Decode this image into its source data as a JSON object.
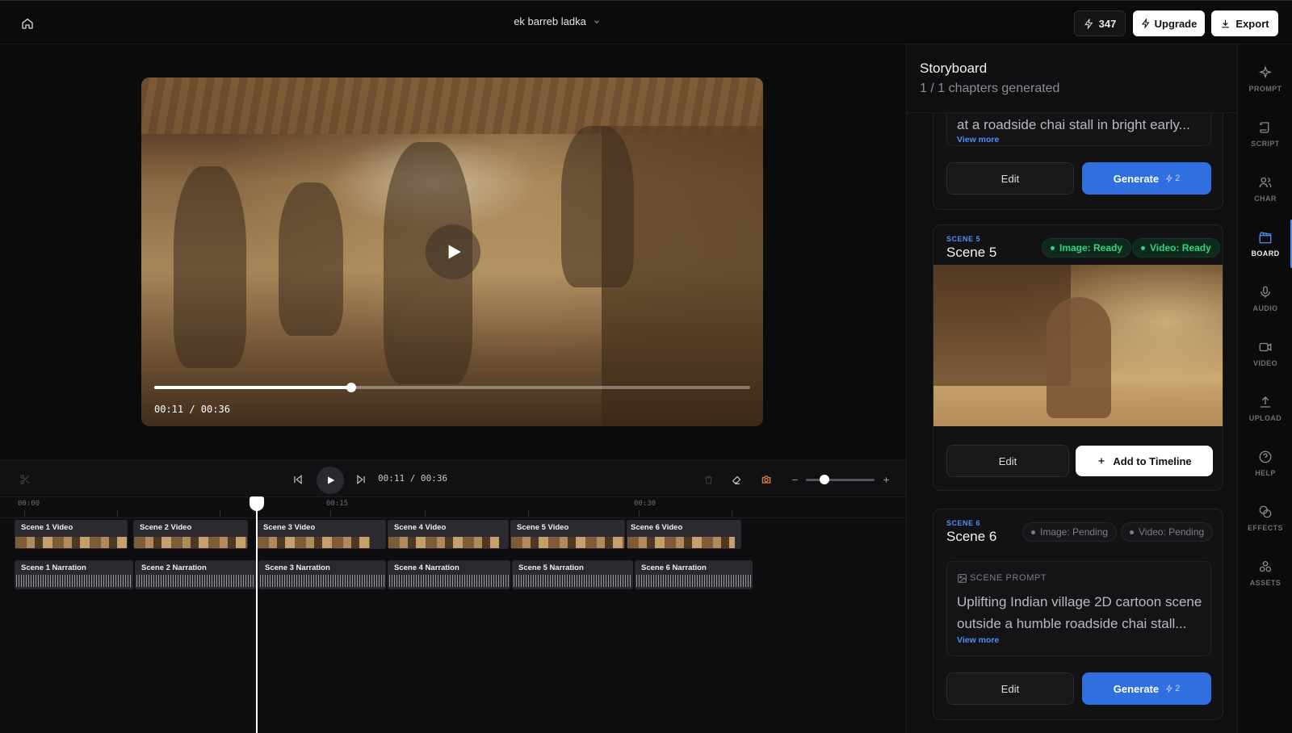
{
  "header": {
    "project_title": "ek barreb ladka",
    "credits": "347",
    "upgrade_label": "Upgrade",
    "export_label": "Export"
  },
  "preview": {
    "time_display": "00:11 / 00:36",
    "progress": 0.33
  },
  "timeline": {
    "time_display": "00:11 / 00:36",
    "ruler": [
      "00:00",
      "00:15",
      "00:30"
    ],
    "video_clips": [
      "Scene 1 Video",
      "Scene 2 Video",
      "Scene 3 Video",
      "Scene 4 Video",
      "Scene 5 Video",
      "Scene 6 Video"
    ],
    "narration_clips": [
      "Scene 1 Narration",
      "Scene 2 Narration",
      "Scene 3 Narration",
      "Scene 4 Narration",
      "Scene 5 Narration",
      "Scene 6 Narration"
    ]
  },
  "storyboard": {
    "title": "Storyboard",
    "subtitle": "1 / 1 chapters generated",
    "scene4": {
      "prompt_tail": "at a roadside chai stall in bright early...",
      "view_more": "View more",
      "edit_label": "Edit",
      "generate_label": "Generate",
      "generate_cost": "2"
    },
    "scene5": {
      "kicker": "SCENE 5",
      "name": "Scene 5",
      "image_status": "Image: Ready",
      "video_status": "Video: Ready",
      "edit_label": "Edit",
      "add_label": "Add to Timeline"
    },
    "scene6": {
      "kicker": "SCENE 6",
      "name": "Scene 6",
      "image_status": "Image: Pending",
      "video_status": "Video: Pending",
      "prompt_label": "SCENE PROMPT",
      "prompt_text": "Uplifting Indian village 2D cartoon scene outside a humble roadside chai stall...",
      "view_more": "View more",
      "edit_label": "Edit",
      "generate_label": "Generate",
      "generate_cost": "2"
    }
  },
  "rail": {
    "items": [
      "PROMPT",
      "SCRIPT",
      "CHAR",
      "BOARD",
      "AUDIO",
      "VIDEO",
      "UPLOAD",
      "HELP",
      "EFFECTS",
      "ASSETS"
    ],
    "active": "BOARD"
  },
  "colors": {
    "accent": "#2f6fe0",
    "ready": "#2fd480"
  }
}
